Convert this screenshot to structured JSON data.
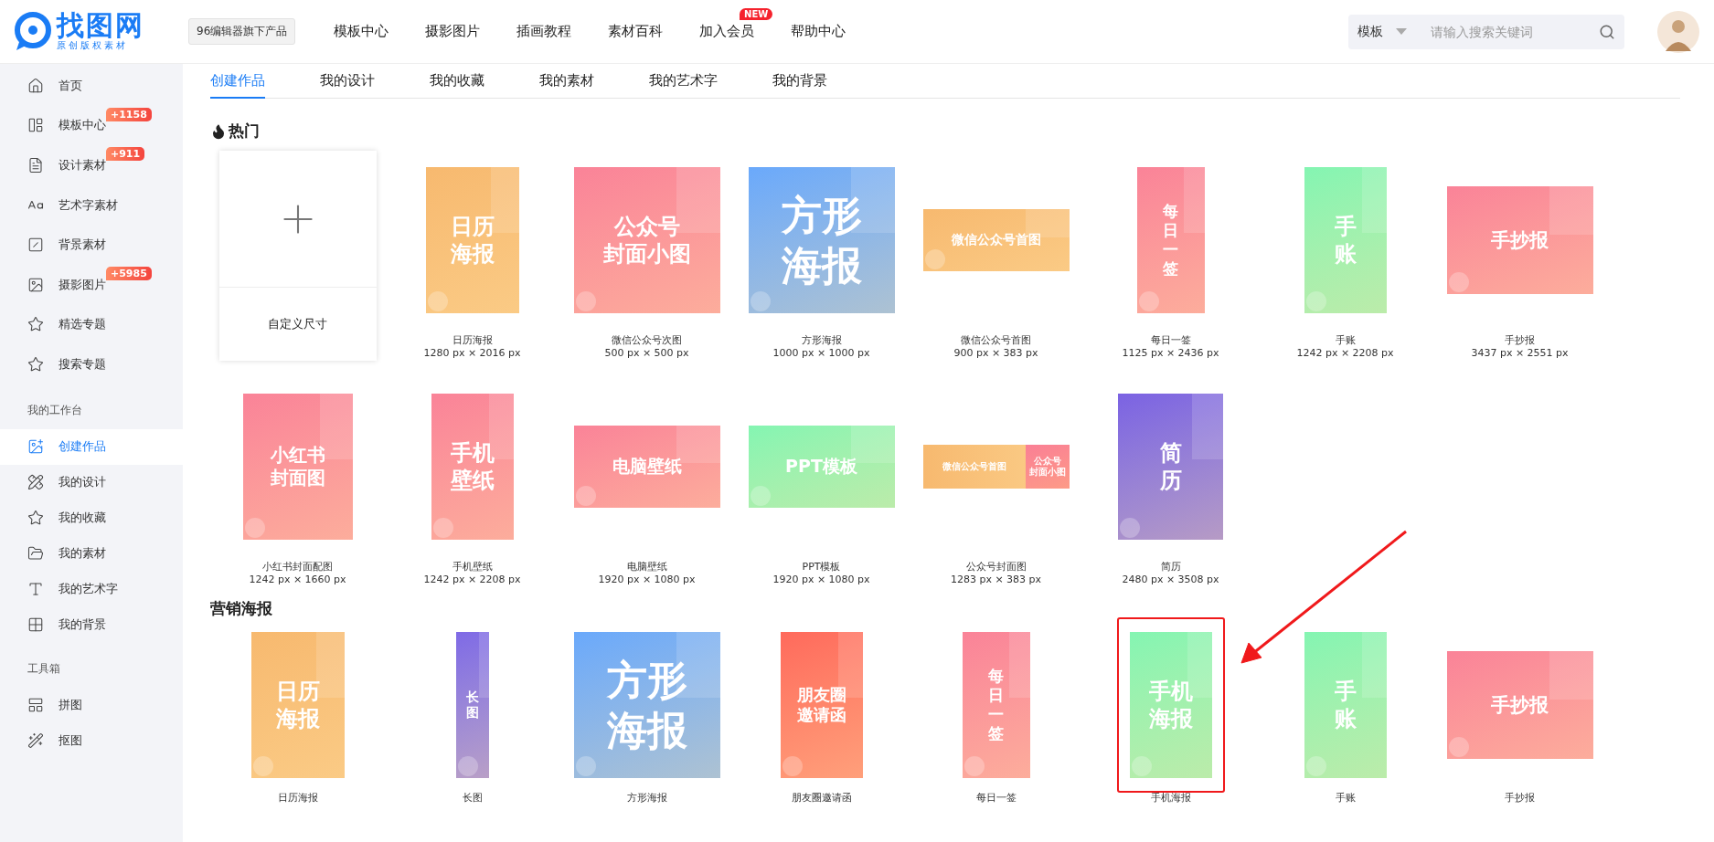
{
  "header": {
    "logo": {
      "name": "找图网",
      "slogan": "原创版权素材"
    },
    "product_tag": "96编辑器旗下产品",
    "nav": [
      {
        "label": "模板中心"
      },
      {
        "label": "摄影图片"
      },
      {
        "label": "插画教程"
      },
      {
        "label": "素材百科"
      },
      {
        "label": "加入会员",
        "badge": "NEW"
      },
      {
        "label": "帮助中心"
      }
    ],
    "search": {
      "category": "模板",
      "placeholder": "请输入搜索关键词"
    }
  },
  "sidebar": {
    "groups": [
      {
        "items": [
          {
            "label": "首页",
            "selected": false
          },
          {
            "label": "模板中心",
            "badge": "+1158",
            "selected": false
          },
          {
            "label": "设计素材",
            "badge": "+911",
            "selected": false
          },
          {
            "label": "艺术字素材",
            "selected": false
          },
          {
            "label": "背景素材",
            "selected": false
          },
          {
            "label": "摄影图片",
            "badge": "+5985",
            "selected": false
          },
          {
            "label": "精选专题",
            "selected": false
          },
          {
            "label": "搜索专题",
            "selected": false
          }
        ]
      },
      {
        "title": "我的工作台",
        "items": [
          {
            "label": "创建作品",
            "selected": true
          },
          {
            "label": "我的设计",
            "selected": false
          },
          {
            "label": "我的收藏",
            "selected": false
          },
          {
            "label": "我的素材",
            "selected": false
          },
          {
            "label": "我的艺术字",
            "selected": false
          },
          {
            "label": "我的背景",
            "selected": false
          }
        ]
      },
      {
        "title": "工具箱",
        "items": [
          {
            "label": "拼图",
            "selected": false
          },
          {
            "label": "抠图",
            "selected": false
          }
        ]
      }
    ]
  },
  "tabs": [
    {
      "label": "创建作品",
      "selected": true
    },
    {
      "label": "我的设计",
      "selected": false
    },
    {
      "label": "我的收藏",
      "selected": false
    },
    {
      "label": "我的素材",
      "selected": false
    },
    {
      "label": "我的艺术字",
      "selected": false
    },
    {
      "label": "我的背景",
      "selected": false
    }
  ],
  "sections": [
    {
      "title": "热门",
      "hot": true,
      "items": [
        {
          "kind": "custom",
          "name": "自定义尺寸"
        },
        {
          "kind": "portrait",
          "color": "#f7b96f",
          "lines": [
            "日历",
            "海报"
          ],
          "name": "日历海报",
          "size": "1280 px × 2016 px",
          "highlighted": false
        },
        {
          "kind": "square",
          "color": "#fa8398",
          "lines": [
            "公众号",
            "封面小图"
          ],
          "name": "微信公众号次图",
          "size": "500 px × 500 px",
          "highlighted": false
        },
        {
          "kind": "square",
          "color": "#6aa9fb",
          "lines": [
            "方形",
            "海报"
          ],
          "name": "方形海报",
          "size": "1000 px × 1000 px",
          "highlighted": false
        },
        {
          "kind": "banner",
          "color": "#f7b96f",
          "lines": [
            "微信公众号首图"
          ],
          "name": "微信公众号首图",
          "size": "900 px × 383 px",
          "highlighted": false
        },
        {
          "kind": "slip",
          "color": "#fa8398",
          "lines": [
            "每",
            "日",
            "一",
            "签"
          ],
          "name": "每日一签",
          "size": "1125 px × 2436 px",
          "highlighted": false
        },
        {
          "kind": "phone",
          "color": "#84f5b2",
          "lines": [
            "手",
            "账"
          ],
          "name": "手账",
          "size": "1242 px × 2208 px",
          "highlighted": false
        },
        {
          "kind": "sheet",
          "color": "#fa8398",
          "lines": [
            "手抄报"
          ],
          "name": "手抄报",
          "size": "3437 px × 2551 px",
          "highlighted": false
        },
        {
          "kind": "cover",
          "color": "#fa8398",
          "lines": [
            "小红书",
            "封面图"
          ],
          "name": "小红书封面配图",
          "size": "1242 px × 1660 px",
          "highlighted": false
        },
        {
          "kind": "phone",
          "color": "#fa8398",
          "lines": [
            "手机",
            "壁纸"
          ],
          "name": "手机壁纸",
          "size": "1242 px × 2208 px",
          "highlighted": false
        },
        {
          "kind": "screen",
          "color": "#fa8398",
          "lines": [
            "电脑壁纸"
          ],
          "name": "电脑壁纸",
          "size": "1920 px × 1080 px",
          "highlighted": false
        },
        {
          "kind": "screen",
          "color": "#84f5b2",
          "lines": [
            "PPT模板"
          ],
          "name": "PPT模板",
          "size": "1920 px × 1080 px",
          "highlighted": false
        },
        {
          "kind": "split",
          "color": "#f7b96f",
          "lines": [
            "微信公众号首图"
          ],
          "side_lines": [
            "公众号",
            "封面小图"
          ],
          "name": "公众号封面图",
          "size": "1283 px × 383 px",
          "highlighted": false
        },
        {
          "kind": "resume",
          "color": "#7b62e3",
          "lines": [
            "简",
            "历"
          ],
          "name": "简历",
          "size": "2480 px × 3508 px",
          "highlighted": false
        }
      ]
    },
    {
      "title": "营销海报",
      "hot": false,
      "items": [
        {
          "kind": "portrait",
          "color": "#f7b96f",
          "lines": [
            "日历",
            "海报"
          ],
          "name": "日历海报",
          "highlighted": false
        },
        {
          "kind": "long",
          "color": "#7f6ae6",
          "lines": [
            "长",
            "图"
          ],
          "name": "长图",
          "highlighted": false
        },
        {
          "kind": "square",
          "color": "#6aa9fb",
          "lines": [
            "方形",
            "海报"
          ],
          "name": "方形海报",
          "highlighted": false
        },
        {
          "kind": "phone",
          "color": "#ff6a5c",
          "lines": [
            "朋友圈",
            "邀请函"
          ],
          "name": "朋友圈邀请函",
          "highlighted": false
        },
        {
          "kind": "slip",
          "color": "#fa8398",
          "lines": [
            "每",
            "日",
            "一",
            "签"
          ],
          "name": "每日一签",
          "highlighted": false
        },
        {
          "kind": "phone",
          "color": "#84f5b2",
          "lines": [
            "手机",
            "海报"
          ],
          "name": "手机海报",
          "highlighted": true
        },
        {
          "kind": "phone",
          "color": "#84f5b2",
          "lines": [
            "手",
            "账"
          ],
          "name": "手账",
          "highlighted": false
        },
        {
          "kind": "sheet",
          "color": "#fa8398",
          "lines": [
            "手抄报"
          ],
          "name": "手抄报",
          "highlighted": false
        }
      ]
    }
  ]
}
